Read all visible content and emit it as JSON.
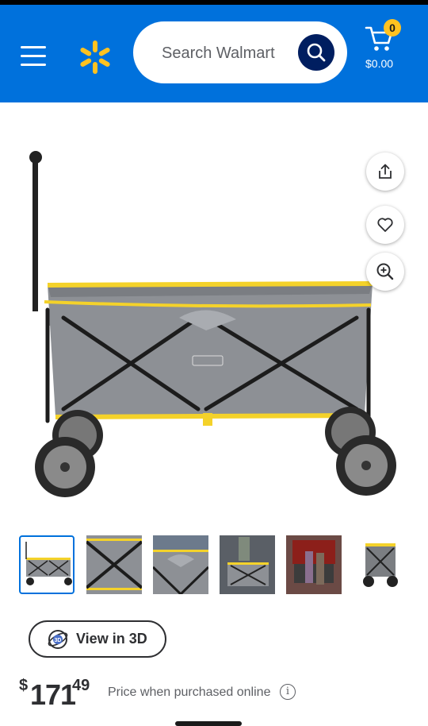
{
  "header": {
    "search_placeholder": "Search Walmart",
    "cart_count": "0",
    "cart_total": "$0.00",
    "brand_color": "#0071dc",
    "spark_color": "#ffc220"
  },
  "product": {
    "image_description_icon": "folding-wagon-image",
    "actions": [
      "share-icon",
      "heart-icon",
      "zoom-in-icon"
    ],
    "thumbnail_count": 6,
    "selected_thumbnail": 1
  },
  "view3d": {
    "label": "View in 3D"
  },
  "price": {
    "currency": "$",
    "dollars": "171",
    "cents": "49",
    "note": "Price when purchased online",
    "info_icon": "i"
  }
}
